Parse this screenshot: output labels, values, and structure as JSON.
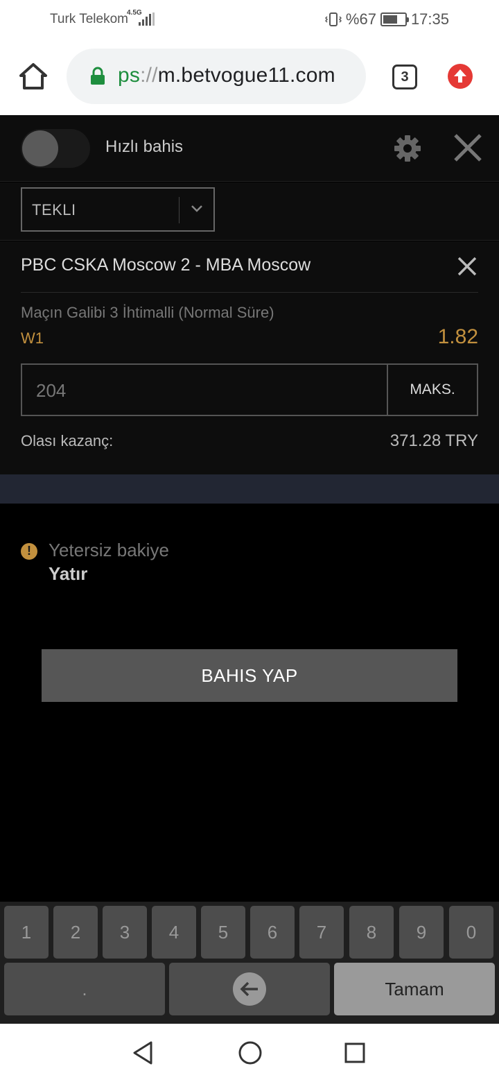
{
  "status_bar": {
    "carrier": "Turk Telekom",
    "network_type": "4.5G",
    "battery_percent": "%67",
    "time": "17:35"
  },
  "browser": {
    "url_scheme_visible": "ps",
    "url_separator": "://",
    "url_host": "m.betvogue11.com",
    "tab_count": "3"
  },
  "slip": {
    "quick_bet_label": "Hızlı bahis",
    "quick_bet_enabled": false,
    "bet_type": "TEKLI",
    "event_title": "PBC CSKA Moscow 2 - MBA Moscow",
    "market": "Maçın Galibi 3 İhtimalli (Normal Süre)",
    "selection": "W1",
    "odds": "1.82",
    "stake": "204",
    "max_button": "MAKS.",
    "potential_win_label": "Olası kazanç:",
    "potential_win_value": "371.28 TRY",
    "warning_text": "Yetersiz bakiye",
    "deposit_link": "Yatır",
    "place_bet_button": "BAHIS YAP"
  },
  "keypad": {
    "digits": [
      "1",
      "2",
      "3",
      "4",
      "5",
      "6",
      "7",
      "8",
      "9",
      "0"
    ],
    "decimal": ".",
    "done": "Tamam"
  },
  "colors": {
    "accent_gold": "#c2903e",
    "ssl_green": "#1e8e3e",
    "update_red": "#e53935"
  },
  "icons": {
    "browser": [
      "home-icon",
      "lock-icon",
      "tab-switcher-icon",
      "update-icon"
    ],
    "slip": [
      "gear-icon",
      "close-icon",
      "chevron-down-icon",
      "warning-icon"
    ],
    "nav": [
      "back-triangle-icon",
      "home-circle-icon",
      "recents-square-icon"
    ]
  }
}
